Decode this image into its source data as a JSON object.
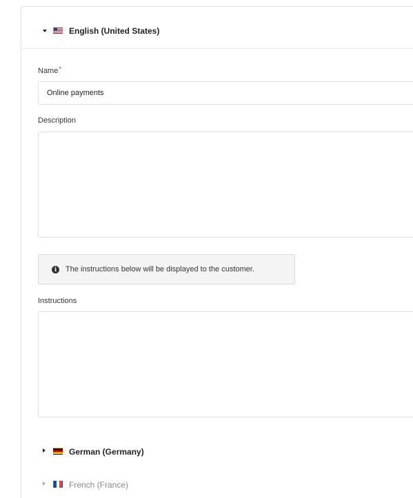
{
  "english": {
    "title": "English (United States)",
    "flag_icon": "flag-us-icon",
    "expanded": true,
    "name_label": "Name",
    "required_marker": "*",
    "name_value": "Online payments",
    "description_label": "Description",
    "description_value": "",
    "notice_text": "The instructions below will be displayed to the customer.",
    "instructions_label": "Instructions",
    "instructions_value": ""
  },
  "other_languages": [
    {
      "title": "German (Germany)",
      "flag_icon": "flag-de-icon",
      "expanded": false
    },
    {
      "title": "French (France)",
      "flag_icon": "flag-fr-icon",
      "expanded": false
    }
  ],
  "colors": {
    "required": "#d9232d",
    "notice_background": "#f4f4f4",
    "border": "#dedede",
    "muted_text": "#8a8a8a"
  }
}
